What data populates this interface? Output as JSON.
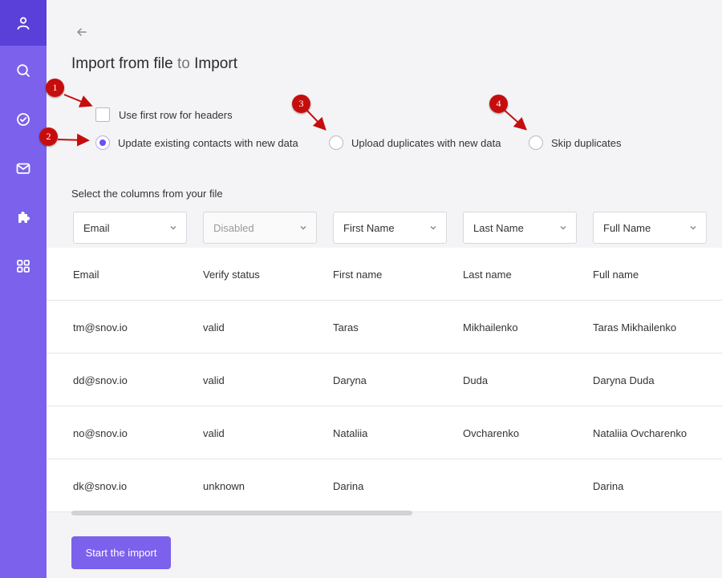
{
  "sidebar": {
    "items": [
      {
        "icon": "person-icon"
      },
      {
        "icon": "search-icon"
      },
      {
        "icon": "check-circle-icon"
      },
      {
        "icon": "mail-icon"
      },
      {
        "icon": "puzzle-icon"
      },
      {
        "icon": "grid-icon"
      }
    ],
    "accent": "#7b61ec",
    "active_color": "#5b3fd9"
  },
  "header": {
    "title_part1": "Import from file",
    "title_part2": "to",
    "title_part3": "Import"
  },
  "options": {
    "use_first_row": "Use first row for headers",
    "update_existing": "Update existing contacts with new data",
    "upload_duplicates": "Upload duplicates with new data",
    "skip_duplicates": "Skip duplicates",
    "selected": "update_existing"
  },
  "columns_label": "Select the columns from your file",
  "selects": [
    {
      "value": "Email"
    },
    {
      "value": "Disabled"
    },
    {
      "value": "First Name"
    },
    {
      "value": "Last Name"
    },
    {
      "value": "Full Name"
    }
  ],
  "table": {
    "headers": [
      "Email",
      "Verify status",
      "First name",
      "Last name",
      "Full name"
    ],
    "rows": [
      [
        "tm@snov.io",
        "valid",
        "Taras",
        "Mikhailenko",
        "Taras Mikhailenko"
      ],
      [
        "dd@snov.io",
        "valid",
        "Daryna",
        "Duda",
        "Daryna Duda"
      ],
      [
        "no@snov.io",
        "valid",
        "Nataliia",
        "Ovcharenko",
        "Nataliia Ovcharenko"
      ],
      [
        "dk@snov.io",
        "unknown",
        "Darina",
        "",
        "Darina"
      ]
    ]
  },
  "start_button": "Start the import",
  "markers": [
    "1",
    "2",
    "3",
    "4"
  ],
  "marker_color": "#c60d0d"
}
